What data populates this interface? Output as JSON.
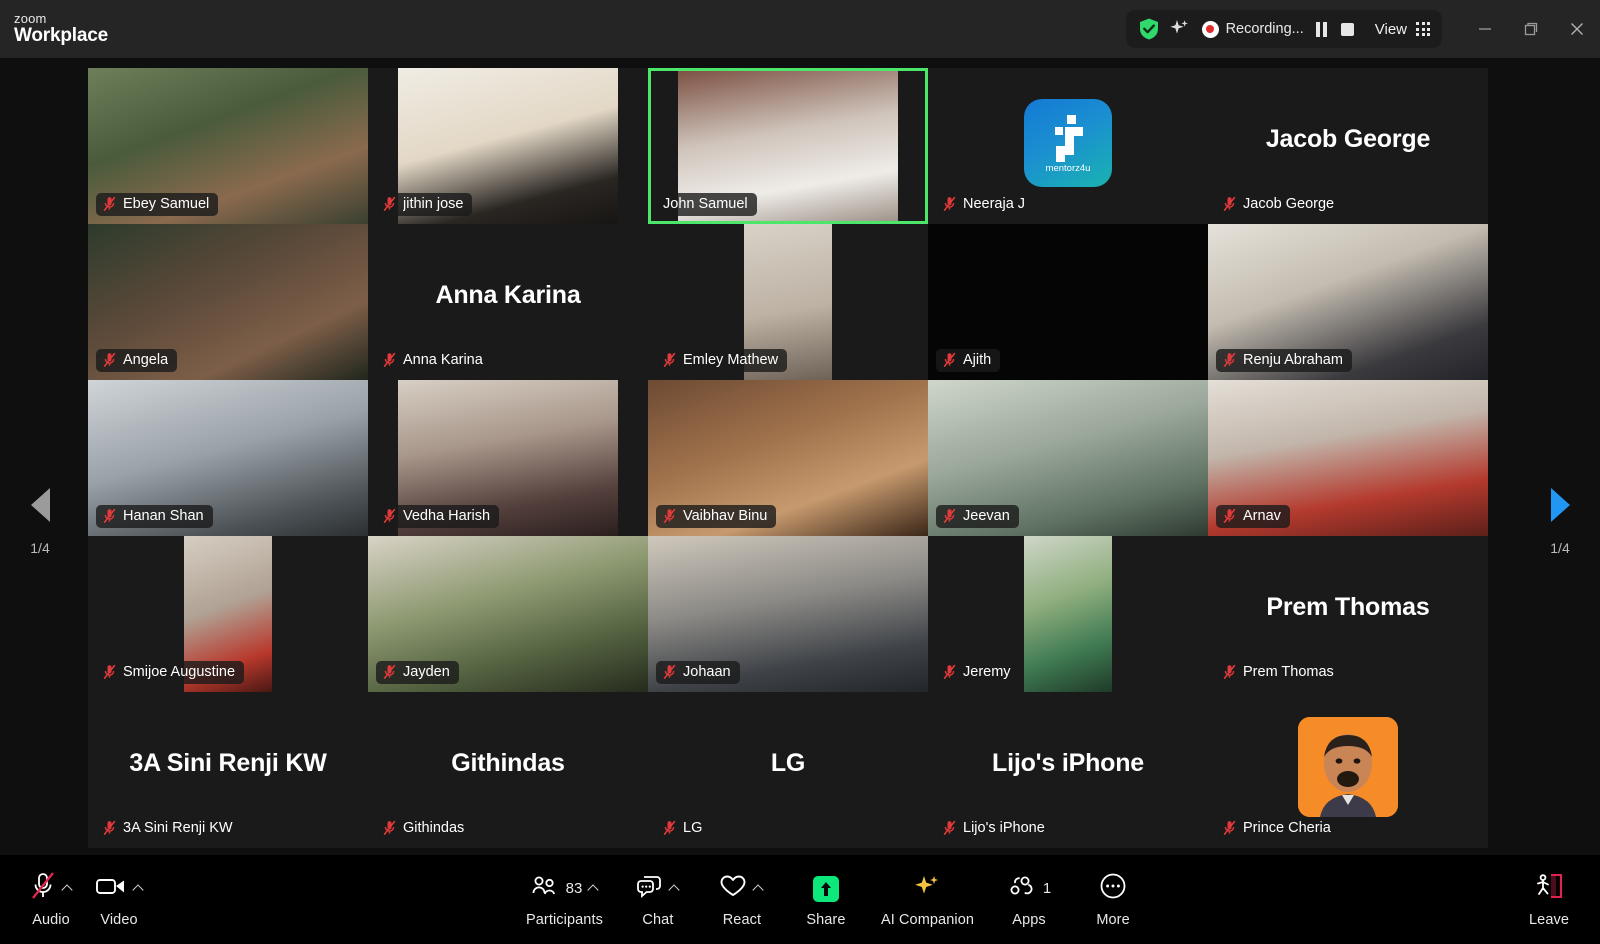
{
  "app": {
    "brand_line1": "zoom",
    "brand_line2": "Workplace"
  },
  "titlebar": {
    "shield_icon": "security-shield-icon",
    "sparkle_icon": "ai-sparkle-icon",
    "recording_label": "Recording...",
    "recording_dot_color": "#e02d2d",
    "pause_recording_label": "pause-recording",
    "stop_recording_label": "stop-recording",
    "view_label": "View",
    "view_grid_icon": "grid-view-icon",
    "minimize_label": "minimize",
    "maximize_label": "restore",
    "close_label": "close"
  },
  "stage": {
    "pager_left": {
      "page_indicator": "1/4",
      "icon": "chevron-left-icon",
      "enabled": false
    },
    "pager_right": {
      "page_indicator": "1/4",
      "icon": "chevron-right-icon",
      "enabled": true
    },
    "active_speaker_color": "#4ce66b"
  },
  "participants": [
    {
      "name": "Ebey Samuel",
      "muted": true,
      "mode": "video",
      "fill": "full",
      "active": false
    },
    {
      "name": "jithin jose",
      "muted": true,
      "mode": "video",
      "fill": "inset-x",
      "active": false
    },
    {
      "name": "John Samuel",
      "muted": false,
      "mode": "video",
      "fill": "inset-x",
      "active": true
    },
    {
      "name": "Neeraja J",
      "muted": true,
      "mode": "logo",
      "fill": "none",
      "active": false
    },
    {
      "name": "Jacob George",
      "muted": true,
      "mode": "name",
      "fill": "none",
      "active": false
    },
    {
      "name": "Angela",
      "muted": true,
      "mode": "video",
      "fill": "full",
      "active": false
    },
    {
      "name": "Anna Karina",
      "muted": true,
      "mode": "name",
      "fill": "none",
      "active": false
    },
    {
      "name": "Emley Mathew",
      "muted": true,
      "mode": "video",
      "fill": "narrow",
      "active": false
    },
    {
      "name": "Ajith",
      "muted": true,
      "mode": "black",
      "fill": "full",
      "active": false
    },
    {
      "name": "Renju Abraham",
      "muted": true,
      "mode": "video",
      "fill": "full",
      "active": false
    },
    {
      "name": "Hanan Shan",
      "muted": true,
      "mode": "video",
      "fill": "full",
      "active": false
    },
    {
      "name": "Vedha Harish",
      "muted": true,
      "mode": "video",
      "fill": "inset-x",
      "active": false
    },
    {
      "name": "Vaibhav Binu",
      "muted": true,
      "mode": "video",
      "fill": "full",
      "active": false
    },
    {
      "name": "Jeevan",
      "muted": true,
      "mode": "video",
      "fill": "full",
      "active": false
    },
    {
      "name": "Arnav",
      "muted": true,
      "mode": "video",
      "fill": "full",
      "active": false
    },
    {
      "name": "Smijoe Augustine",
      "muted": true,
      "mode": "video",
      "fill": "narrow",
      "active": false
    },
    {
      "name": "Jayden",
      "muted": true,
      "mode": "video",
      "fill": "full",
      "active": false
    },
    {
      "name": "Johaan",
      "muted": true,
      "mode": "video",
      "fill": "full",
      "active": false
    },
    {
      "name": "Jeremy",
      "muted": true,
      "mode": "video",
      "fill": "narrow",
      "active": false
    },
    {
      "name": "Prem Thomas",
      "muted": true,
      "mode": "name",
      "fill": "none",
      "active": false
    },
    {
      "name": "3A Sini Renji KW",
      "muted": true,
      "mode": "name",
      "fill": "none",
      "active": false
    },
    {
      "name": "Githindas",
      "muted": true,
      "mode": "name",
      "fill": "none",
      "active": false
    },
    {
      "name": "LG",
      "muted": true,
      "mode": "name",
      "fill": "none",
      "active": false
    },
    {
      "name": "Lijo's iPhone",
      "muted": true,
      "mode": "name",
      "fill": "none",
      "active": false
    },
    {
      "name": "Prince Cheria",
      "muted": true,
      "mode": "photo",
      "fill": "none",
      "active": false
    }
  ],
  "toolbar": {
    "audio": {
      "label": "Audio",
      "icon": "microphone-muted-icon",
      "has_caret": true,
      "muted": true
    },
    "video": {
      "label": "Video",
      "icon": "camera-icon",
      "has_caret": true
    },
    "participants": {
      "label": "Participants",
      "icon": "participants-icon",
      "count": "83",
      "has_caret": true
    },
    "chat": {
      "label": "Chat",
      "icon": "chat-bubble-icon",
      "has_caret": true
    },
    "react": {
      "label": "React",
      "icon": "heart-icon",
      "has_caret": true
    },
    "share": {
      "label": "Share",
      "icon": "share-screen-icon",
      "accent": "#0ce87c"
    },
    "ai_companion": {
      "label": "AI Companion",
      "icon": "ai-sparkle-icon",
      "accent": "#f5c542"
    },
    "apps": {
      "label": "Apps",
      "icon": "apps-icon",
      "count": "1"
    },
    "more": {
      "label": "More",
      "icon": "more-ellipsis-icon"
    },
    "leave": {
      "label": "Leave",
      "icon": "leave-door-icon",
      "accent": "#e02d4f"
    }
  }
}
